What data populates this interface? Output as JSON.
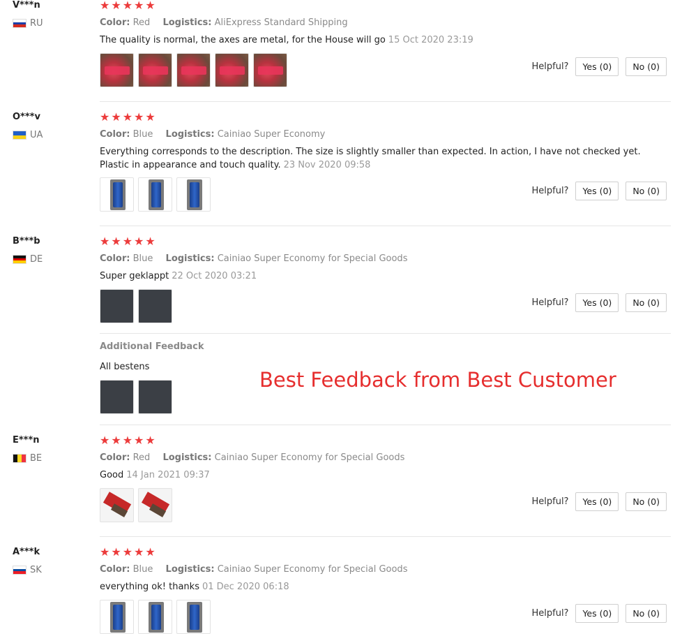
{
  "labels": {
    "color": "Color:",
    "logistics": "Logistics:",
    "helpful": "Helpful?",
    "additional_feedback": "Additional Feedback"
  },
  "stars": "★★★★★",
  "overlay_text": "Best Feedback from Best Customer",
  "reviews": [
    {
      "user": "V***n",
      "country": "RU",
      "color": "Red",
      "logistics": "AliExpress Standard Shipping",
      "text": "The quality is normal, the axes are metal, for the House will go",
      "date": "15 Oct 2020 23:19",
      "yes": "Yes (0)",
      "no": "No (0)"
    },
    {
      "user": "O***v",
      "country": "UA",
      "color": "Blue",
      "logistics": "Cainiao Super Economy",
      "text1": "Everything corresponds to the description. The size is slightly smaller than expected. In action, I have not checked yet.",
      "text2": "Plastic in appearance and touch quality.",
      "date": "23 Nov 2020 09:58",
      "yes": "Yes (0)",
      "no": "No (0)"
    },
    {
      "user": "B***b",
      "country": "DE",
      "color": "Blue",
      "logistics": "Cainiao Super Economy for Special Goods",
      "text": "Super geklappt",
      "date": "22 Oct 2020 03:21",
      "yes": "Yes (0)",
      "no": "No (0)",
      "additional_text": "All bestens"
    },
    {
      "user": "E***n",
      "country": "BE",
      "color": "Red",
      "logistics": "Cainiao Super Economy for Special Goods",
      "text": "Good",
      "date": "14 Jan 2021 09:37",
      "yes": "Yes (0)",
      "no": "No (0)"
    },
    {
      "user": "A***k",
      "country": "SK",
      "color": "Blue",
      "logistics": "Cainiao Super Economy for Special Goods",
      "text": "everything ok! thanks",
      "date": "01 Dec 2020 06:18",
      "yes": "Yes (0)",
      "no": "No (0)"
    }
  ]
}
